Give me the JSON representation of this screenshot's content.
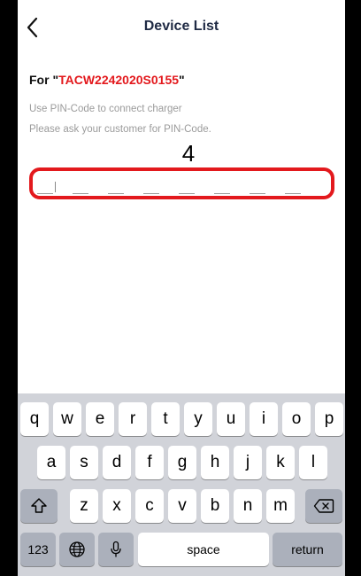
{
  "nav": {
    "title": "Device List",
    "back_icon": "chevron-left-icon"
  },
  "prompt": {
    "prefix": "For \"",
    "serial": "TACW2242020S0155",
    "suffix": "\"",
    "hint1": "Use PIN-Code to connect charger",
    "hint2": "Please ask your customer for PIN-Code."
  },
  "pin": {
    "entered_digit": "4",
    "slots": 8
  },
  "colors": {
    "accent": "#e3191d",
    "title": "#1f2a44",
    "hint": "#9b9b9b"
  },
  "keyboard": {
    "row1": [
      "q",
      "w",
      "e",
      "r",
      "t",
      "y",
      "u",
      "i",
      "o",
      "p"
    ],
    "row2": [
      "a",
      "s",
      "d",
      "f",
      "g",
      "h",
      "j",
      "k",
      "l"
    ],
    "row3": [
      "z",
      "x",
      "c",
      "v",
      "b",
      "n",
      "m"
    ],
    "shift_icon": "shift-icon",
    "delete_icon": "backspace-icon",
    "numbers_label": "123",
    "globe_icon": "globe-icon",
    "mic_icon": "microphone-icon",
    "space_label": "space",
    "return_label": "return"
  }
}
